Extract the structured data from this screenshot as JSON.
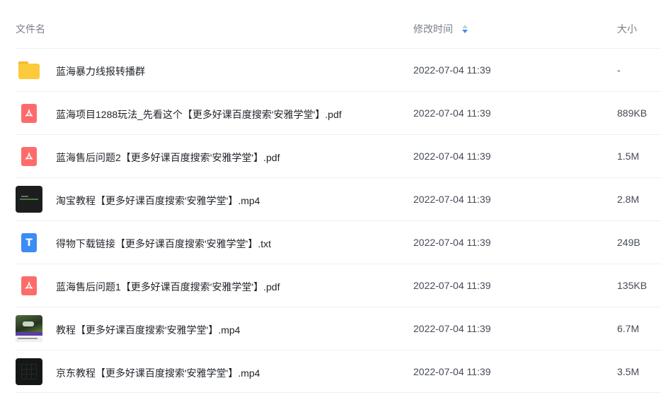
{
  "columns": {
    "name": "文件名",
    "modified": "修改时间",
    "size": "大小"
  },
  "sort": {
    "column": "modified",
    "icon": "sort-icon",
    "accent_color": "#3b8cf5"
  },
  "files": [
    {
      "icon": "folder-icon",
      "name": "蓝海暴力线报转播群",
      "modified": "2022-07-04 11:39",
      "size": "-"
    },
    {
      "icon": "pdf-icon",
      "name": "蓝海项目1288玩法_先看这个【更多好课百度搜索'安雅学堂'】.pdf",
      "modified": "2022-07-04 11:39",
      "size": "889KB"
    },
    {
      "icon": "pdf-icon",
      "name": "蓝海售后问题2【更多好课百度搜索'安雅学堂'】.pdf",
      "modified": "2022-07-04 11:39",
      "size": "1.5M"
    },
    {
      "icon": "video-thumbnail-icon",
      "name": "淘宝教程【更多好课百度搜索'安雅学堂'】.mp4",
      "modified": "2022-07-04 11:39",
      "size": "2.8M"
    },
    {
      "icon": "txt-icon",
      "name": "得物下载链接【更多好课百度搜索'安雅学堂'】.txt",
      "modified": "2022-07-04 11:39",
      "size": "249B"
    },
    {
      "icon": "pdf-icon",
      "name": "蓝海售后问题1【更多好课百度搜索'安雅学堂'】.pdf",
      "modified": "2022-07-04 11:39",
      "size": "135KB"
    },
    {
      "icon": "video-thumbnail-icon",
      "name": "教程【更多好课百度搜索'安雅学堂'】.mp4",
      "modified": "2022-07-04 11:39",
      "size": "6.7M"
    },
    {
      "icon": "video-thumbnail-icon",
      "name": "京东教程【更多好课百度搜索'安雅学堂'】.mp4",
      "modified": "2022-07-04 11:39",
      "size": "3.5M"
    }
  ],
  "colors": {
    "folder": "#fcca3b",
    "pdf": "#ff6b6b",
    "txt": "#3b8cf5"
  }
}
